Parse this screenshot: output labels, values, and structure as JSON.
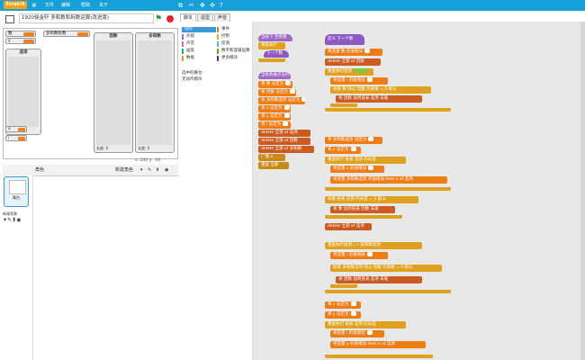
{
  "topbar": {
    "logo": "Scratch",
    "menus": [
      "文件",
      "编辑",
      "帮助",
      "关于"
    ]
  },
  "project": {
    "title": "1920徐金轩 多和数和拆数运算(改进版)"
  },
  "stage": {
    "monitors": [
      {
        "label": "数"
      },
      {
        "label": "多和数拆数"
      },
      {
        "label": "y"
      }
    ],
    "lists": [
      {
        "title": "选项",
        "footer": "长度: 0"
      },
      {
        "title": "因数",
        "footer": "长度: 0"
      },
      {
        "title": "多和数",
        "footer": "长度: 0"
      }
    ],
    "small_monitors": [
      {
        "label": "x"
      },
      {
        "label": "i"
      }
    ],
    "coords": "x: 240  y: -44"
  },
  "sprites": {
    "header": "角色",
    "new_label": "新建角色",
    "tile": "角色1",
    "stage_label": "舞台",
    "bg_label": "新建背景"
  },
  "tabs": [
    "脚本",
    "造型",
    "声音"
  ],
  "categories_left": [
    "动作",
    "外观",
    "声音",
    "画笔",
    "数据"
  ],
  "categories_right": [
    "事件",
    "控制",
    "侦测",
    "数字和逻辑运算",
    "更多模块"
  ],
  "palette": {
    "note1": "选中的舞台:",
    "note2": "无动作模块"
  },
  "blocks": {
    "hat1": "当按下 空格键",
    "broadcast": "重复执行",
    "nextbtn": "下一个数",
    "hat2": "当角色被点击时",
    "set1": "将 数 设定为",
    "set2": "将 因数 设定为",
    "set3": "将 多和数选项 设定为",
    "set4": "将 x 设定为",
    "set5": "将 y 设定为",
    "set6": "将 i 设定为",
    "del1": "delete 全部 of 选项",
    "del2": "delete 全部 of 因数",
    "del3": "delete 全部 of 多和数",
    "broadcast2": "广播 x",
    "broadcast3": "重复 全部",
    "define": "定义 下一个数",
    "s1": "将变量 数 的值增加",
    "s2": "delete 全部 of 因数",
    "s3": "重复执行直到",
    "s4": "将变量 i 的值增加",
    "s5": "如果 数 除以 因数 的余数 = 0 那么",
    "s6": "将 因数 加到链表 选项 末尾",
    "s7": "将 多和数选项 设定为",
    "s8": "将 x 设定为",
    "s9": "重复执行 链表 选项 的长度",
    "s10": "将变量 x 的值增加",
    "s11": "将变量 多和数选项 的值增加 item x of 选项",
    "s12": "如果 链表 选项 的长度 = 2 那么",
    "s13": "将 数 加到链表 因数 末尾",
    "s14": "delete 全部 of 选项",
    "s15": "重复执行直到 i > 多和数选项",
    "s16": "将变量 i 的值增加",
    "s17": "如果 多和数选项 除以 因数 的余数 = 0 那么",
    "s18": "将 因数 加到链表 选项 末尾",
    "s19": "将 x 设定为",
    "s20": "将 y 设定为",
    "s21": "重复执行 链表 选项 的长度",
    "s22": "将变量 y 的值增加 item x of 选项"
  }
}
